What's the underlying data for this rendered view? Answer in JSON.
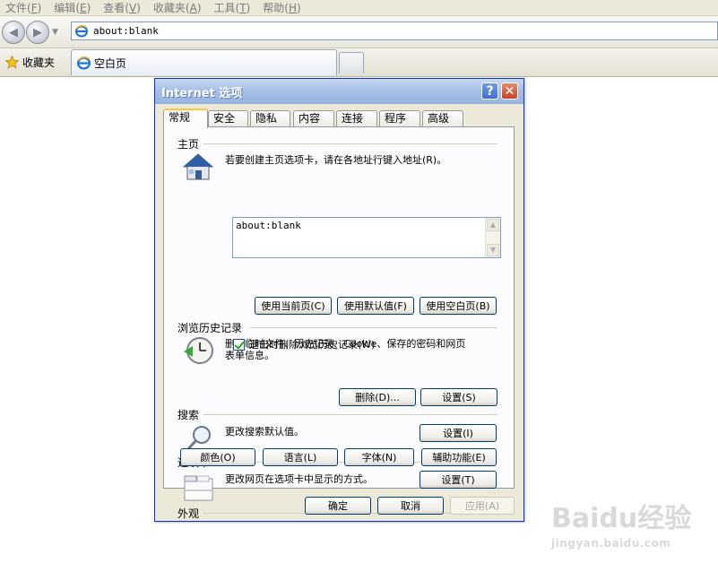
{
  "menubar": {
    "items": [
      {
        "label": "文件",
        "key": "F"
      },
      {
        "label": "编辑",
        "key": "E"
      },
      {
        "label": "查看",
        "key": "V"
      },
      {
        "label": "收藏夹",
        "key": "A"
      },
      {
        "label": "工具",
        "key": "T"
      },
      {
        "label": "帮助",
        "key": "H"
      }
    ]
  },
  "address": {
    "value": "about:blank"
  },
  "favorites": {
    "label": "收藏夹"
  },
  "tab": {
    "label": "空白页"
  },
  "dialog": {
    "title": "Internet 选项",
    "help_glyph": "?",
    "close_glyph": "✕",
    "tabs": [
      "常规",
      "安全",
      "隐私",
      "内容",
      "连接",
      "程序",
      "高级"
    ],
    "homepage": {
      "group": "主页",
      "desc": "若要创建主页选项卡，请在各地址行键入地址(R)。",
      "value": "about:blank",
      "buttons": [
        "使用当前页(C)",
        "使用默认值(F)",
        "使用空白页(B)"
      ]
    },
    "history": {
      "group": "浏览历史记录",
      "desc_line1": "删除临时文件、历史记录、Cookie、保存的密码和网页",
      "desc_line2": "表单信息。",
      "checkbox_label": "退出时删除浏览历史记录(W)",
      "delete_button": "删除(D)...",
      "settings_button": "设置(S)"
    },
    "search": {
      "group": "搜索",
      "desc": "更改搜索默认值。",
      "settings_button": "设置(I)"
    },
    "tabs_group": {
      "group": "选项卡",
      "desc": "更改网页在选项卡中显示的方式。",
      "settings_button": "设置(T)"
    },
    "appearance": {
      "group": "外观",
      "buttons": [
        "颜色(O)",
        "语言(L)",
        "字体(N)",
        "辅助功能(E)"
      ]
    },
    "footer": {
      "ok": "确定",
      "cancel": "取消",
      "apply": "应用(A)"
    }
  },
  "watermark": {
    "brand": "Baidu经验",
    "sub": "jingyan.baidu.com"
  },
  "colors": {
    "accent_border": "#0831d9",
    "button_border": "#003c74",
    "tab_highlight": "#ffc83c"
  }
}
